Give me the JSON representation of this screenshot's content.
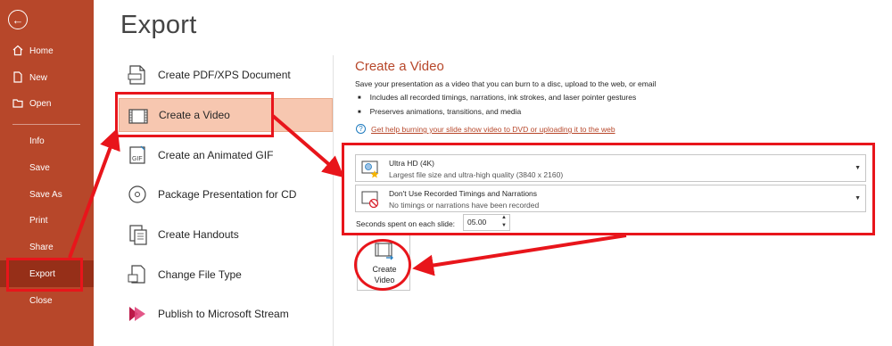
{
  "colors": {
    "accent": "#b7472a",
    "annotation": "#e8151b",
    "selected_bg": "#f7c7b0"
  },
  "sidebar": {
    "back_icon": "back-arrow-icon",
    "items": [
      {
        "label": "Home",
        "icon": "home-icon"
      },
      {
        "label": "New",
        "icon": "new-document-icon"
      },
      {
        "label": "Open",
        "icon": "folder-icon"
      },
      {
        "label": "Info"
      },
      {
        "label": "Save"
      },
      {
        "label": "Save As"
      },
      {
        "label": "Print"
      },
      {
        "label": "Share"
      },
      {
        "label": "Export",
        "selected": true
      },
      {
        "label": "Close"
      }
    ]
  },
  "page_title": "Export",
  "options": [
    {
      "label": "Create PDF/XPS Document",
      "icon": "pdf-document-icon"
    },
    {
      "label": "Create a Video",
      "icon": "video-film-icon",
      "selected": true
    },
    {
      "label": "Create an Animated GIF",
      "icon": "gif-icon"
    },
    {
      "label": "Package Presentation for CD",
      "icon": "cd-icon"
    },
    {
      "label": "Create Handouts",
      "icon": "handouts-icon"
    },
    {
      "label": "Change File Type",
      "icon": "file-type-icon"
    },
    {
      "label": "Publish to Microsoft Stream",
      "icon": "stream-icon"
    }
  ],
  "detail": {
    "title": "Create a Video",
    "description": "Save your presentation as a video that you can burn to a disc, upload to the web, or email",
    "bullets": [
      "Includes all recorded timings, narrations, ink strokes, and laser pointer gestures",
      "Preserves animations, transitions, and media"
    ],
    "help_link": "Get help burning your slide show video to DVD or uploading it to the web",
    "quality_dropdown": {
      "title": "Ultra HD (4K)",
      "subtitle": "Largest file size and ultra-high quality (3840 x 2160)"
    },
    "timing_dropdown": {
      "title": "Don't Use Recorded Timings and Narrations",
      "subtitle": "No timings or narrations have been recorded"
    },
    "seconds_label": "Seconds spent on each slide:",
    "seconds_value": "05.00",
    "create_button": {
      "line1": "Create",
      "line2": "Video"
    }
  }
}
